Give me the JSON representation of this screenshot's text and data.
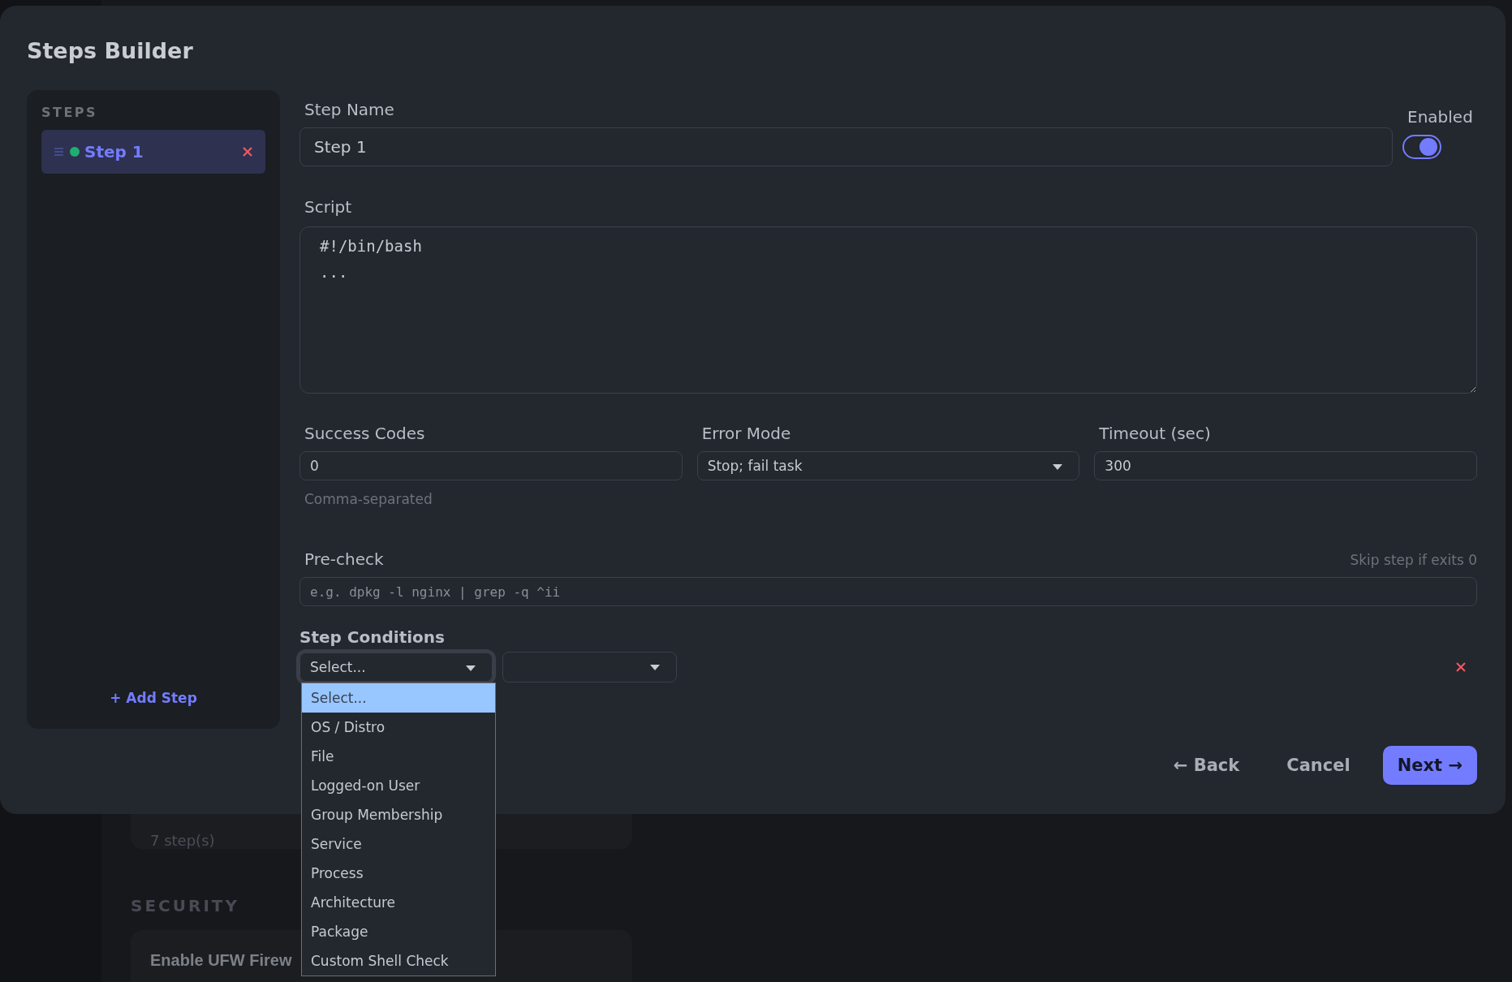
{
  "background": {
    "card": {
      "subtitle": "7 step(s)"
    },
    "section_heading": "SECURITY",
    "card_2": {
      "title": "Enable UFW Firew"
    }
  },
  "modal": {
    "title": "Steps Builder",
    "sidebar": {
      "heading": "STEPS",
      "steps": [
        {
          "name": "Step 1",
          "selected": true,
          "color": "#1fae72"
        }
      ],
      "add_button": "+ Add Step"
    },
    "step_name": {
      "label": "Step Name",
      "value": "Step 1"
    },
    "enabled": {
      "label": "Enabled",
      "on": true
    },
    "script": {
      "label": "Script",
      "value": "#!/bin/bash\n..."
    },
    "success_codes": {
      "label": "Success Codes",
      "value": "0",
      "hint": "Comma-separated"
    },
    "error_mode": {
      "label": "Error Mode",
      "value": "Stop; fail task"
    },
    "timeout": {
      "label": "Timeout (sec)",
      "value": "300"
    },
    "pre_check": {
      "label": "Pre-check",
      "hint": "Skip step if exits 0",
      "placeholder": "e.g. dpkg -l nginx | grep -q ^ii"
    },
    "step_conditions": {
      "label": "Step Conditions",
      "rows": [
        {
          "type": {
            "value": "Select...",
            "expanded": true
          }
        }
      ],
      "options": [
        {
          "label": "Select...",
          "selected": true
        },
        {
          "label": "OS / Distro",
          "selected": false
        },
        {
          "label": "File",
          "selected": false
        },
        {
          "label": "Logged-on User",
          "selected": false
        },
        {
          "label": "Group Membership",
          "selected": false
        },
        {
          "label": "Service",
          "selected": false
        },
        {
          "label": "Process",
          "selected": false
        },
        {
          "label": "Architecture",
          "selected": false
        },
        {
          "label": "Package",
          "selected": false
        },
        {
          "label": "Custom Shell Check",
          "selected": false
        }
      ]
    },
    "buttons": {
      "back": "← Back",
      "cancel": "Cancel",
      "next": "Next →"
    }
  }
}
